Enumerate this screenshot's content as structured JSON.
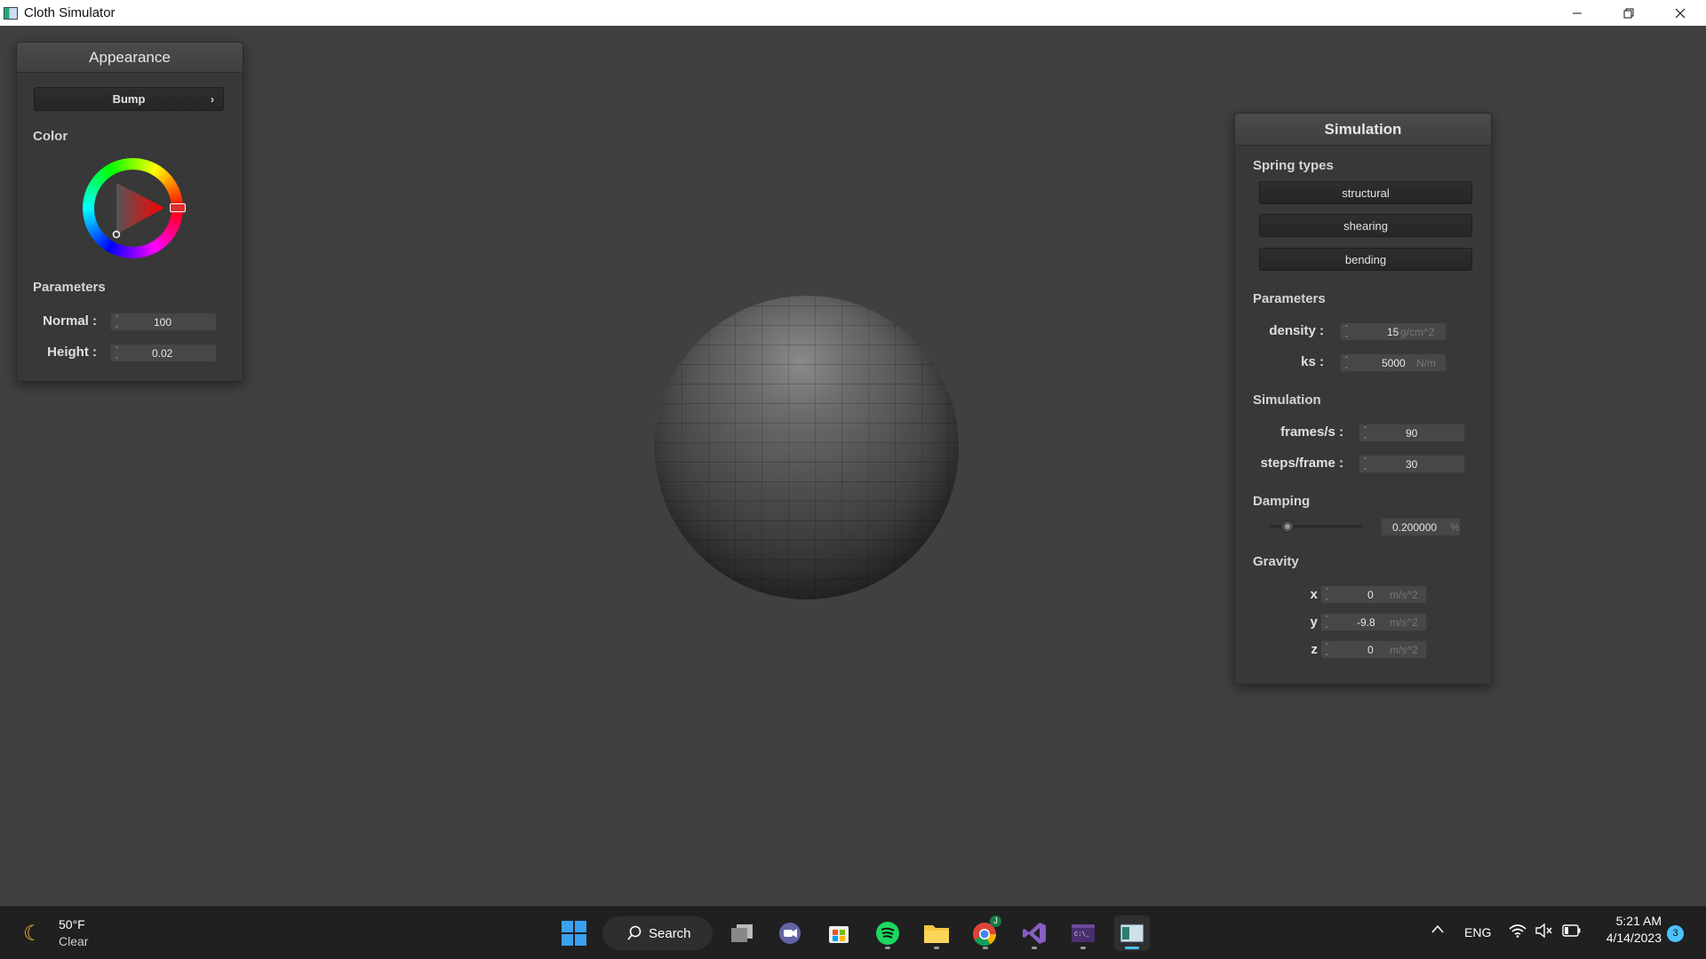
{
  "window": {
    "title": "Cloth Simulator"
  },
  "appearance": {
    "title": "Appearance",
    "dropdown_label": "Bump",
    "color_label": "Color",
    "accent_color": "#d42b2b",
    "parameters_label": "Parameters",
    "normal": {
      "label": "Normal :",
      "value": "100"
    },
    "height": {
      "label": "Height :",
      "value": "0.02"
    }
  },
  "simulation": {
    "title": "Simulation",
    "spring_types_label": "Spring types",
    "spring_buttons": [
      "structural",
      "shearing",
      "bending"
    ],
    "parameters_label": "Parameters",
    "density": {
      "label": "density :",
      "value": "15",
      "unit": "g/cm^2"
    },
    "ks": {
      "label": "ks :",
      "value": "5000",
      "unit": "N/m"
    },
    "sim_label": "Simulation",
    "fps": {
      "label": "frames/s :",
      "value": "90"
    },
    "steps": {
      "label": "steps/frame :",
      "value": "30"
    },
    "damping_label": "Damping",
    "damping": {
      "value": "0.200000",
      "unit": "%",
      "slider_fraction": 0.2
    },
    "gravity_label": "Gravity",
    "gravity": [
      {
        "label": "x :",
        "value": "0",
        "unit": "m/s^2"
      },
      {
        "label": "y :",
        "value": "-9.8",
        "unit": "m/s^2"
      },
      {
        "label": "z :",
        "value": "0",
        "unit": "m/s^2"
      }
    ]
  },
  "taskbar": {
    "weather_temp": "50°F",
    "weather_desc": "Clear",
    "search_label": "Search",
    "lang": "ENG",
    "time": "5:21 AM",
    "date": "4/14/2023",
    "notification_count": "3",
    "chrome_badge": "J"
  }
}
